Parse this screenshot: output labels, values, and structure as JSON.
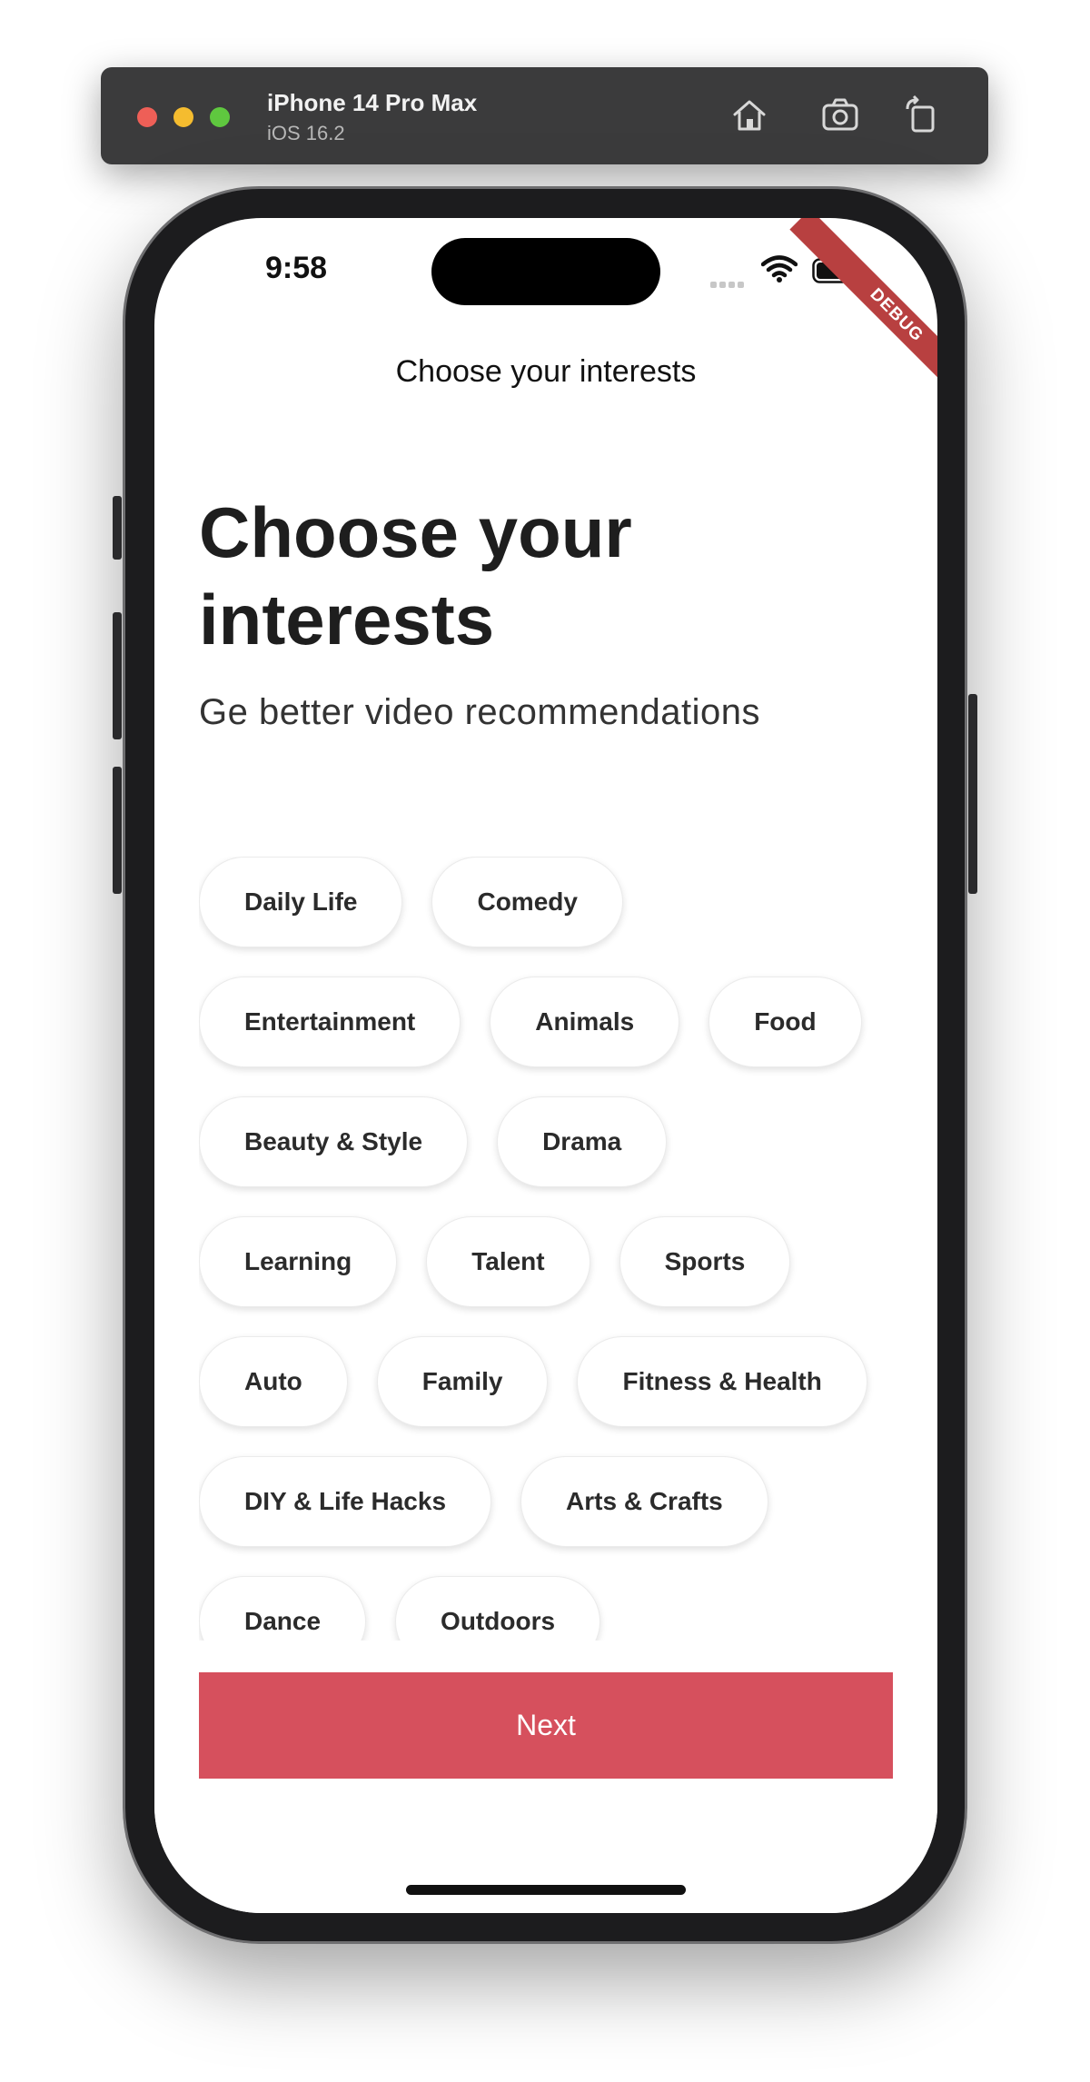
{
  "simulator": {
    "device_name": "iPhone 14 Pro Max",
    "os_version": "iOS 16.2",
    "icons": [
      "home-icon",
      "screenshot-icon",
      "rotate-icon"
    ]
  },
  "status_bar": {
    "time": "9:58",
    "icons": [
      "signal-icon",
      "wifi-icon",
      "battery-icon"
    ]
  },
  "debug_banner": "DEBUG",
  "app_bar": {
    "title": "Choose your interests"
  },
  "main": {
    "headline": "Choose your interests",
    "subtitle": "Ge better video recommendations",
    "chip_rows": [
      [
        "Daily Life",
        "Comedy"
      ],
      [
        "Entertainment",
        "Animals",
        "Food"
      ],
      [
        "Beauty & Style",
        "Drama"
      ],
      [
        "Learning",
        "Talent",
        "Sports"
      ],
      [
        "Auto",
        "Family",
        "Fitness & Health"
      ],
      [
        "DIY & Life Hacks",
        "Arts & Crafts"
      ],
      [
        "Dance",
        "Outdoors"
      ]
    ]
  },
  "footer": {
    "next_label": "Next"
  },
  "colors": {
    "accent": "#d6505d",
    "debug": "#b84040",
    "text": "#1e1e1e"
  }
}
